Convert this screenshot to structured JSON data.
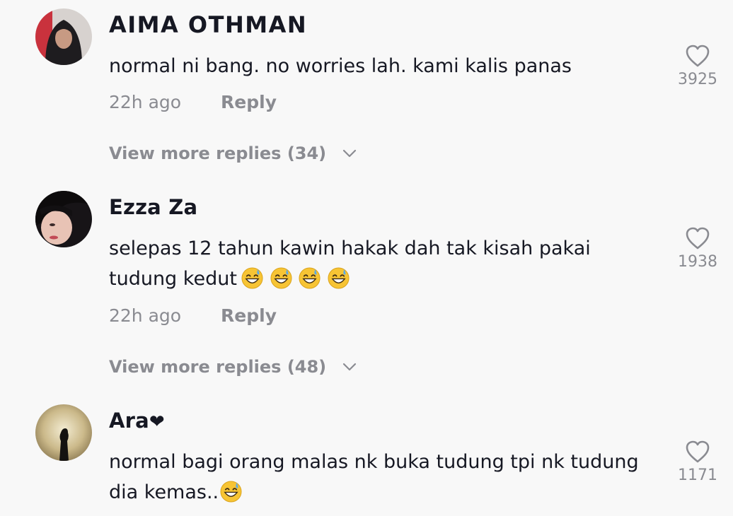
{
  "comments": [
    {
      "username": "AIMA OTHMAN",
      "text": "normal ni bang. no worries lah. kami kalis panas",
      "time": "22h ago",
      "reply_label": "Reply",
      "more_replies": "View more replies (34)",
      "likes": "3925",
      "avatar_icon": "user-avatar-photo"
    },
    {
      "username": "Ezza Za",
      "text": "selepas 12 tahun kawin hakak dah tak kisah pakai tudung kedut",
      "emoji": [
        "grinning-sweat-emoji",
        "grinning-sweat-emoji",
        "grinning-sweat-emoji",
        "grinning-sweat-emoji"
      ],
      "time": "22h ago",
      "reply_label": "Reply",
      "more_replies": "View more replies (48)",
      "likes": "1938",
      "avatar_icon": "user-avatar-photo"
    },
    {
      "username": "Ara",
      "username_suffix": "❤",
      "text": "normal bagi orang malas nk buka tudung tpi nk tudung dia kemas..",
      "emoji": [
        "grinning-sweat-emoji"
      ],
      "likes": "1171",
      "avatar_icon": "user-avatar-photo"
    }
  ],
  "colors": {
    "background": "#f8f8f8",
    "primary_text": "#161823",
    "secondary_text": "#8a8b91",
    "emoji_face": "#f7c434"
  }
}
